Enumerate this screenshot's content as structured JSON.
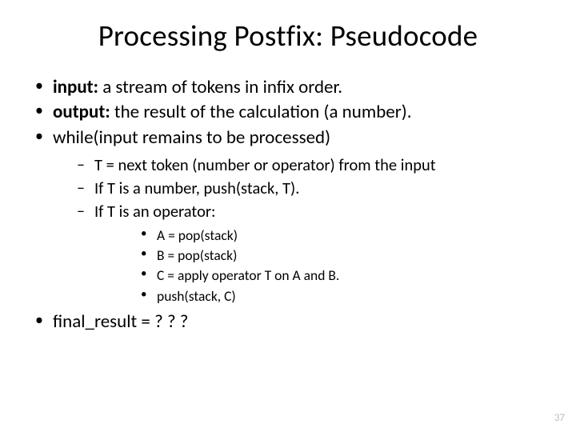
{
  "title": "Processing Postfix: Pseudocode",
  "lvl1": {
    "i0": {
      "bold": "input:",
      "rest": " a stream of tokens in infix order."
    },
    "i1": {
      "bold": "output:",
      "rest": " the result of the calculation (a number)."
    },
    "i2": {
      "text": "while(input remains to be processed)"
    },
    "i3": {
      "text": "final_result = ? ? ?"
    }
  },
  "lvl2": {
    "i0": "T = next token (number or operator) from the input",
    "i1": "If T is a number, push(stack, T).",
    "i2": "If T is an operator:"
  },
  "lvl3": {
    "i0": "A = pop(stack)",
    "i1": "B = pop(stack)",
    "i2": "C = apply operator T on A and B.",
    "i3": "push(stack, C)"
  },
  "pagenum": "37"
}
